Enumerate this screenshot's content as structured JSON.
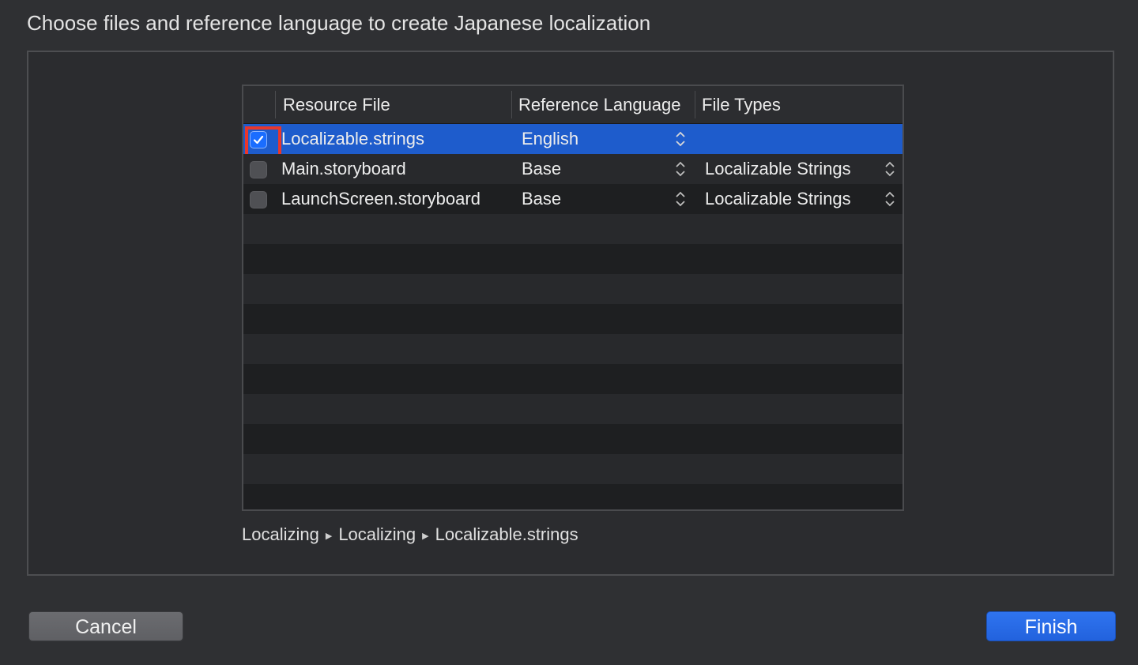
{
  "dialog": {
    "title": "Choose files and reference language to create Japanese localization"
  },
  "table": {
    "columns": [
      "Resource File",
      "Reference Language",
      "File Types"
    ],
    "rows": [
      {
        "checked": true,
        "file": "Localizable.strings",
        "language": "English",
        "file_type": "",
        "selected": true
      },
      {
        "checked": false,
        "file": "Main.storyboard",
        "language": "Base",
        "file_type": "Localizable Strings",
        "selected": false
      },
      {
        "checked": false,
        "file": "LaunchScreen.storyboard",
        "language": "Base",
        "file_type": "Localizable Strings",
        "selected": false
      }
    ]
  },
  "breadcrumb": {
    "items": [
      "Localizing",
      "Localizing",
      "Localizable.strings"
    ],
    "separator_icon": "triangle-right-icon"
  },
  "buttons": {
    "cancel_label": "Cancel",
    "finish_label": "Finish"
  },
  "colors": {
    "selection": "#1e5ccc",
    "accent": "#2a6ae8",
    "highlight": "#e8372c"
  }
}
